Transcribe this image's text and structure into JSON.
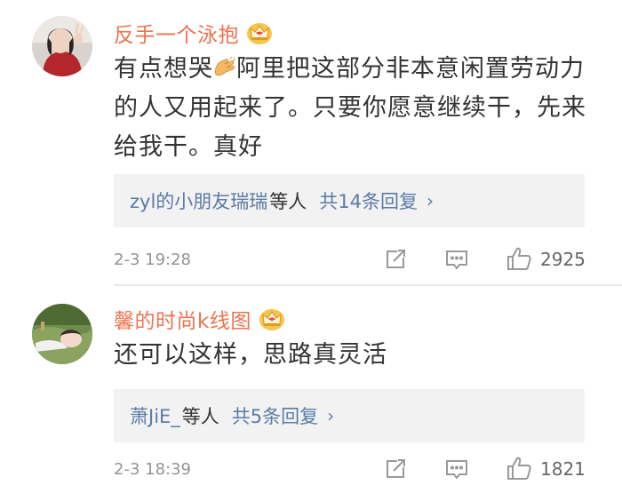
{
  "comments": [
    {
      "username": "反手一个泳抱",
      "content_before_emoji": "有点想哭",
      "emoji": "clapping-hands-emoji",
      "content_after_emoji": "阿里把这部分非本意闲置劳动力的人又用起来了。只要你愿意继续干，先来给我干。真好",
      "replies": {
        "names": "zyl的小朋友瑞瑞",
        "suffix": "等人",
        "count_text": "共14条回复",
        "arrow": "›"
      },
      "time": "2-3 19:28",
      "likes": "2925"
    },
    {
      "username": "馨的时尚k线图",
      "content": "还可以这样，思路真灵活",
      "replies": {
        "names": "萧JiE_",
        "suffix": "等人",
        "count_text": "共5条回复",
        "arrow": "›"
      },
      "time": "2-3 18:39",
      "likes": "1821"
    }
  ],
  "colors": {
    "username": "#eb7350",
    "link": "#5b7ba8",
    "text": "#333333",
    "meta": "#939393",
    "reply_bg": "#f2f2f2",
    "crown": "#f5b93a"
  }
}
